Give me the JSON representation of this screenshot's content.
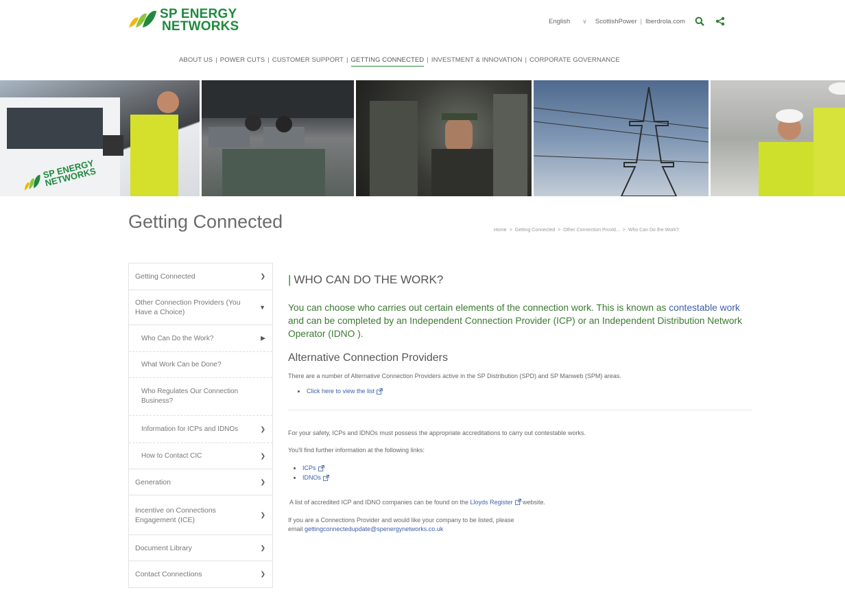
{
  "header": {
    "logo_line1": "SP ENERGY",
    "logo_line2": "NETWORKS",
    "language": "English",
    "links": [
      "ScottishPower",
      "Iberdrola.com"
    ],
    "search_icon": "search-icon",
    "share_icon": "share-icon",
    "colors": {
      "brand_green": "#1f8a3d",
      "accent_yellow": "#f2b705",
      "link_blue": "#3c5fa8"
    }
  },
  "nav": {
    "items": [
      "ABOUT US",
      "POWER CUTS",
      "CUSTOMER SUPPORT",
      "GETTING CONNECTED",
      "INVESTMENT & INNOVATION",
      "CORPORATE GOVERNANCE"
    ],
    "active_index": 3
  },
  "banner": {
    "van_logo_line1": "SP ENERGY",
    "van_logo_line2": "NETWORKS"
  },
  "page": {
    "title": "Getting Connected",
    "breadcrumb": [
      "Home",
      "Getting Connected",
      "Other Connection Provid...",
      "Who Can Do the Work?"
    ]
  },
  "sidebar": {
    "items": [
      {
        "label": "Getting Connected",
        "icon": "chevron-down-icon"
      },
      {
        "label": "Other Connection Providers (You Have a Choice)",
        "icon": "caret-down-icon"
      },
      {
        "label": "Who Can Do the Work?",
        "icon": "caret-right-icon",
        "sub": true
      },
      {
        "label": "What Work Can be Done?",
        "sub": true
      },
      {
        "label": "Who Regulates Our Connection Business?",
        "sub": true
      },
      {
        "label": "Information for ICPs and IDNOs",
        "icon": "chevron-down-icon",
        "sub": true
      },
      {
        "label": "How to Contact CIC",
        "icon": "chevron-down-icon",
        "sub": true
      },
      {
        "label": "Generation",
        "icon": "chevron-down-icon"
      },
      {
        "label": "Incentive on Connections Engagement (ICE)",
        "icon": "chevron-down-icon"
      },
      {
        "label": "Document Library",
        "icon": "chevron-down-icon"
      },
      {
        "label": "Contact Connections",
        "icon": "chevron-down-icon"
      }
    ]
  },
  "content": {
    "heading": "WHO CAN DO THE WORK?",
    "lead_before": "You can choose who carries out certain elements of the connection work. This is known as ",
    "lead_link": "contestable work",
    "lead_after": " and can be completed by an Independent Connection Provider (ICP) or an Independent Distribution Network Operator (IDNO ).",
    "subheading": "Alternative Connection Providers",
    "para1": "There are a number of Alternative Connection Providers active in the SP Distribution (SPD) and SP Manweb (SPM) areas.",
    "list1": [
      "Click here to view the list"
    ],
    "para2": "For your safety, ICPs and IDNOs must possess the appropriate accreditations to carry out contestable works.",
    "para3": "You'll find further information at the following links:",
    "list2": [
      "ICPs",
      "IDNOs"
    ],
    "para4_before": "A list of accredited ICP and IDNO companies can be found on the ",
    "para4_link": "Lloyds Register",
    "para4_after": " website.",
    "para5_line1": "If you are a Connections Provider and would like your company to be listed, please",
    "para5_prefix": "email ",
    "para5_email": "gettingconnectedupdate@spenergynetworks.co.uk"
  }
}
